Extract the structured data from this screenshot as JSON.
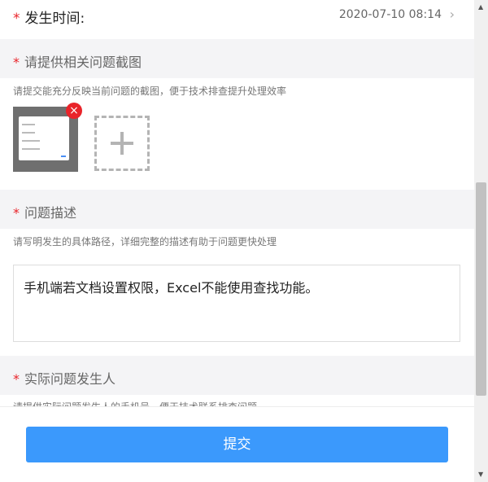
{
  "time_row": {
    "required_mark": "*",
    "label": "发生时间:",
    "value": "2020-07-10 08:14",
    "chevron": "›"
  },
  "screenshot_section": {
    "required_mark": "*",
    "title": "请提供相关问题截图",
    "hint": "请提交能充分反映当前问题的截图，便于技术排查提升处理效率",
    "delete_icon": "×"
  },
  "description_section": {
    "required_mark": "*",
    "title": "问题描述",
    "hint": "请写明发生的具体路径，详细完整的描述有助于问题更快处理",
    "value": "手机端若文档设置权限，Excel不能使用查找功能。"
  },
  "reporter_section": {
    "required_mark": "*",
    "title": "实际问题发生人",
    "hint": "请提供实际问题发生人的手机号，便于技术联系排查问题"
  },
  "submit_label": "提交",
  "colors": {
    "accent": "#3b99fc",
    "required": "#e9242a"
  }
}
